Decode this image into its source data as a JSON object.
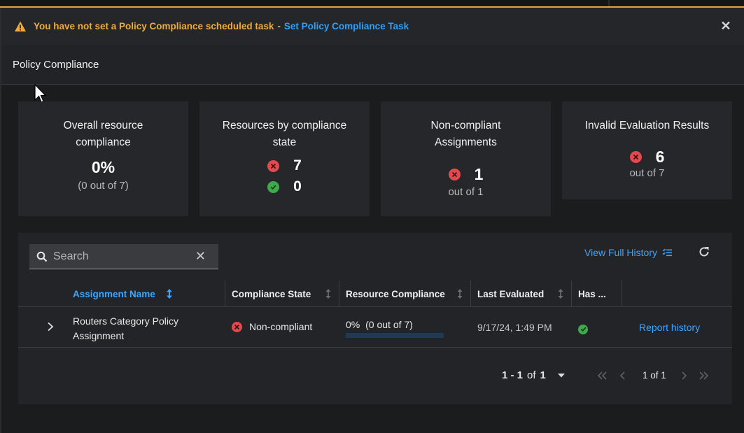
{
  "alert": {
    "message": "You have not set a Policy Compliance scheduled task",
    "separator": "-",
    "link": "Set Policy Compliance Task"
  },
  "page": {
    "title": "Policy Compliance"
  },
  "cards": {
    "overall": {
      "title": "Overall resource compliance",
      "percent": "0%",
      "detail": "(0 out of 7)"
    },
    "by_state": {
      "title": "Resources by compliance state",
      "noncompliant_count": "7",
      "compliant_count": "0"
    },
    "assignments": {
      "title": "Non-compliant Assignments",
      "count": "1",
      "detail": "out of 1"
    },
    "invalid": {
      "title": "Invalid Evaluation Results",
      "count": "6",
      "detail": "out of 7"
    }
  },
  "search": {
    "placeholder": "Search"
  },
  "toolbar": {
    "view_history": "View Full History"
  },
  "table": {
    "columns": [
      "Assignment Name",
      "Compliance State",
      "Resource Compliance",
      "Last Evaluated",
      "Has ..."
    ],
    "rows": [
      {
        "name_line1": "Routers Category Policy",
        "name_line2": "Assignment",
        "state": "Non-compliant",
        "resource_pct": "0%",
        "resource_detail": "(0 out of 7)",
        "resource_fraction": 0,
        "last_evaluated": "9/17/24, 1:49 PM",
        "action": "Report history"
      }
    ]
  },
  "pagination": {
    "range": "1 - 1",
    "of_word": "of",
    "total": "1",
    "page_text": "1 of 1"
  },
  "colors": {
    "accent": "#3ea5ff",
    "warning": "#f0ab3c",
    "danger": "#e5484d",
    "success": "#3fa94b"
  }
}
